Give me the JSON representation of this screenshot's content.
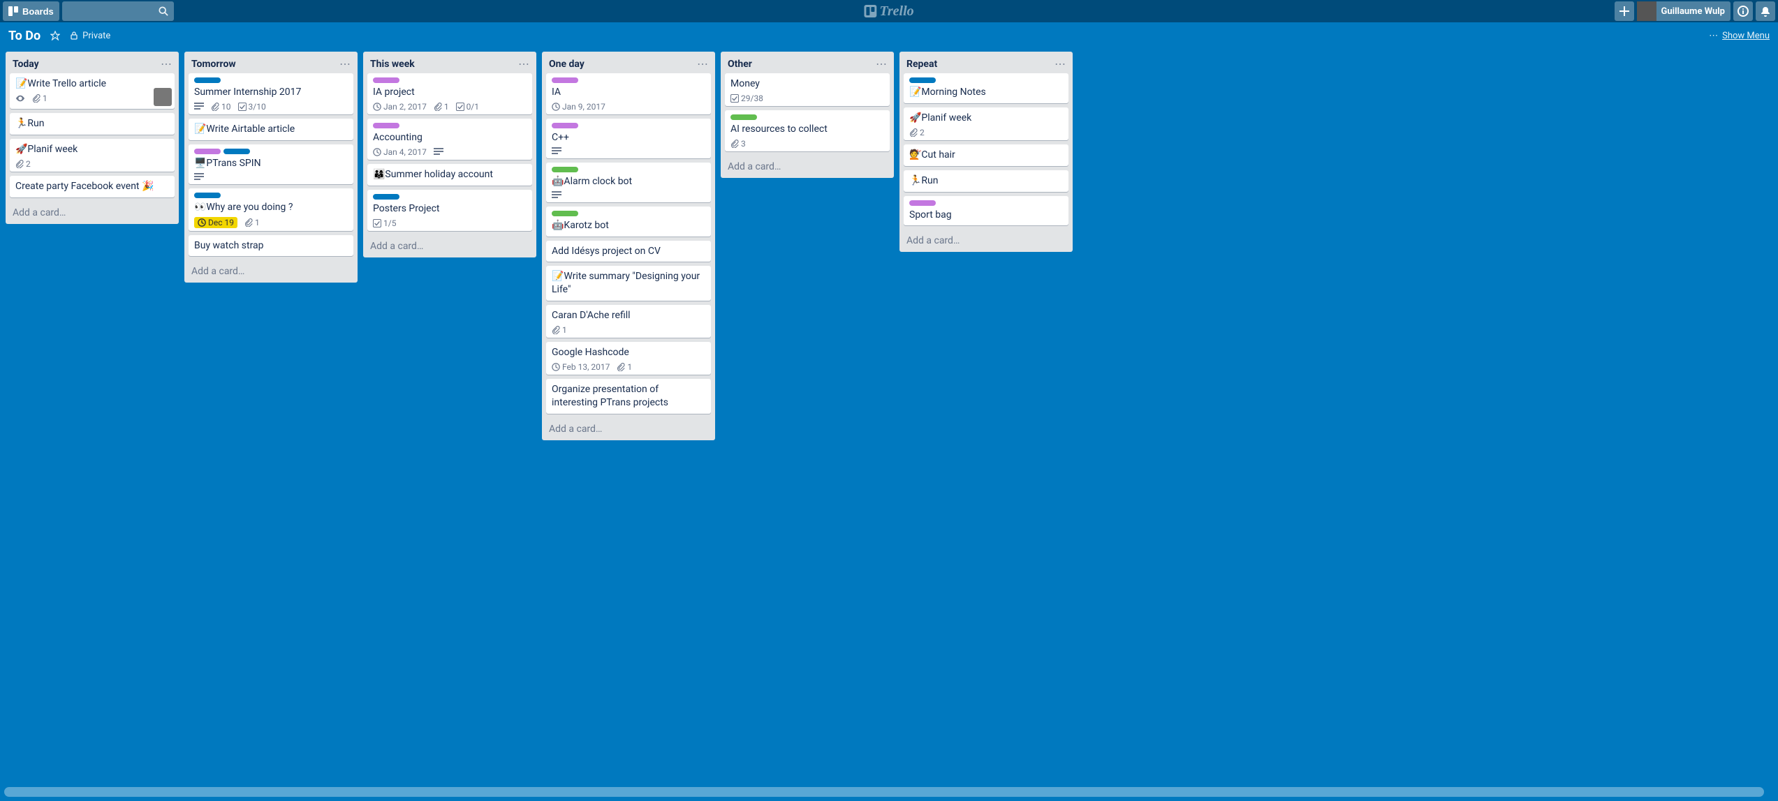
{
  "header": {
    "boards_label": "Boards",
    "user_name": "Guillaume Wulp",
    "logo_text": "Trello"
  },
  "board": {
    "title": "To Do",
    "visibility": "Private",
    "show_menu": "Show Menu"
  },
  "lists": [
    {
      "title": "Today",
      "cards": [
        {
          "title": "📝Write Trello article",
          "badges": {
            "eye": true,
            "attachments": "1",
            "avatar": true
          }
        },
        {
          "title": "🏃Run"
        },
        {
          "title": "🚀Planif week",
          "badges": {
            "attachments": "2"
          }
        },
        {
          "title": "Create party Facebook event 🎉"
        }
      ],
      "add": "Add a card…"
    },
    {
      "title": "Tomorrow",
      "cards": [
        {
          "labels": [
            "blue"
          ],
          "title": "Summer Internship 2017",
          "badges": {
            "desc": true,
            "attachments": "10",
            "checklist": "3/10"
          }
        },
        {
          "title": "📝Write Airtable article"
        },
        {
          "labels": [
            "purple",
            "blue"
          ],
          "title": "🖥️PTrans SPIN",
          "badges": {
            "desc": true
          }
        },
        {
          "labels": [
            "blue"
          ],
          "title": "👀Why are you doing ?",
          "badges": {
            "due": "Dec 19",
            "attachments": "1"
          }
        },
        {
          "title": "Buy watch strap"
        }
      ],
      "add": "Add a card…"
    },
    {
      "title": "This week",
      "cards": [
        {
          "labels": [
            "purple"
          ],
          "title": "IA project",
          "badges": {
            "date": "Jan 2, 2017",
            "attachments": "1",
            "checklist": "0/1"
          }
        },
        {
          "labels": [
            "purple"
          ],
          "title": "Accounting",
          "badges": {
            "date": "Jan 4, 2017",
            "desc": true
          }
        },
        {
          "title": "👨‍👩‍👦Summer holiday account"
        },
        {
          "labels": [
            "blue"
          ],
          "title": "Posters Project",
          "badges": {
            "checklist": "1/5"
          }
        }
      ],
      "add": "Add a card…"
    },
    {
      "title": "One day",
      "cards": [
        {
          "labels": [
            "purple"
          ],
          "title": "IA",
          "badges": {
            "date": "Jan 9, 2017"
          }
        },
        {
          "labels": [
            "purple"
          ],
          "title": "C++",
          "badges": {
            "desc": true
          }
        },
        {
          "labels": [
            "green"
          ],
          "title": "🤖Alarm clock bot",
          "badges": {
            "desc": true
          }
        },
        {
          "labels": [
            "green"
          ],
          "title": "🤖Karotz bot"
        },
        {
          "title": "Add Idésys project on CV"
        },
        {
          "title": "📝Write summary \"Designing your Life\""
        },
        {
          "title": "Caran D'Ache refill",
          "badges": {
            "attachments": "1"
          }
        },
        {
          "title": "Google Hashcode",
          "badges": {
            "date": "Feb 13, 2017",
            "attachments": "1"
          }
        },
        {
          "title": "Organize presentation of interesting PTrans projects"
        }
      ],
      "add": "Add a card…"
    },
    {
      "title": "Other",
      "cards": [
        {
          "title": "Money",
          "badges": {
            "checklist": "29/38"
          }
        },
        {
          "labels": [
            "green"
          ],
          "title": "AI resources to collect",
          "badges": {
            "attachments": "3"
          }
        }
      ],
      "add": "Add a card…"
    },
    {
      "title": "Repeat",
      "cards": [
        {
          "labels": [
            "blue"
          ],
          "title": "📝Morning Notes"
        },
        {
          "title": "🚀Planif week",
          "badges": {
            "attachments": "2"
          }
        },
        {
          "title": "💇Cut hair"
        },
        {
          "title": "🏃Run"
        },
        {
          "labels": [
            "purple"
          ],
          "title": "Sport bag"
        }
      ],
      "add": "Add a card…"
    }
  ]
}
